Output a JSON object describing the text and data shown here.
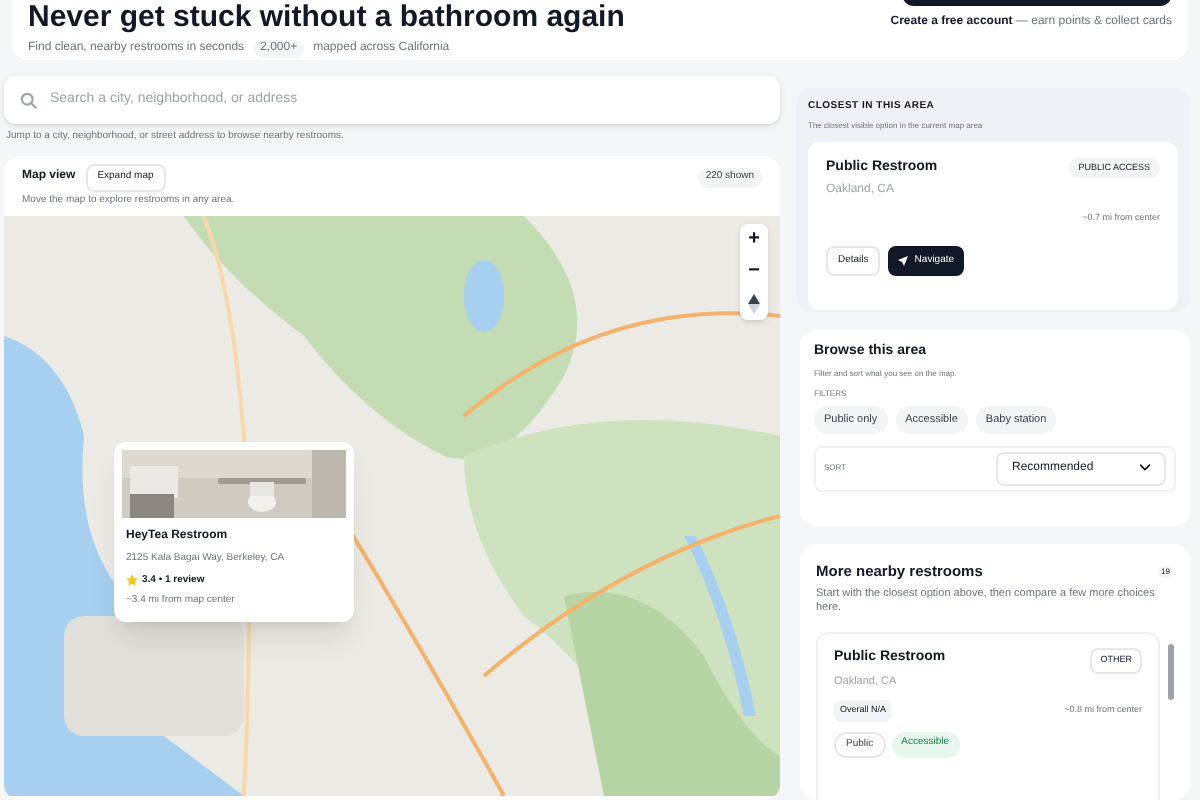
{
  "header": {
    "title": "Never get stuck without a bathroom again",
    "subtitle": "Find clean, nearby restrooms in seconds",
    "count_badge": "2,000+",
    "count_text": "mapped across California",
    "account_link": "Create a free account",
    "account_note": "— earn points & collect cards"
  },
  "search": {
    "placeholder": "Search a city, neighborhood, or address",
    "hint": "Jump to a city, neighborhood, or street address to browse nearby restrooms."
  },
  "map": {
    "title": "Map view",
    "expand_button": "Expand map",
    "shown": "220 shown",
    "hint": "Move the map to explore restrooms in any area.",
    "zoom_in": "+",
    "zoom_out": "−",
    "popup": {
      "name": "HeyTea Restroom",
      "address": "2125 Kala Bagai Way, Berkeley, CA",
      "rating": "3.4 • 1 review",
      "distance": "~3.4 mi from map center"
    }
  },
  "closest": {
    "heading": "CLOSEST IN THIS AREA",
    "subheading": "The closest visible option in the current map area",
    "name": "Public Restroom",
    "place": "Oakland, CA",
    "badge": "PUBLIC ACCESS",
    "distance": "~0.7 mi from center",
    "buttons": [
      "Details",
      "Navigate"
    ]
  },
  "browse": {
    "heading": "Browse this area",
    "subheading": "Filter and sort what you see on the map.",
    "filters_label": "FILTERS",
    "filters": [
      {
        "label": "Public only",
        "selected": false
      },
      {
        "label": "Accessible",
        "selected": false
      },
      {
        "label": "Baby station",
        "selected": false
      }
    ],
    "sort_label": "SORT",
    "sort_value": "Recommended"
  },
  "nearby": {
    "heading": "More nearby restrooms",
    "count": "19",
    "subheading": "Start with the closest option above, then compare a few more choices here.",
    "items": [
      {
        "name": "Public Restroom",
        "place": "Oakland, CA",
        "badge": "OTHER",
        "overall": "Overall N/A",
        "distance": "~0.8 mi from center",
        "tags": [
          {
            "label": "Public",
            "kind": "plain"
          },
          {
            "label": "Accessible",
            "kind": "green"
          }
        ]
      }
    ]
  }
}
